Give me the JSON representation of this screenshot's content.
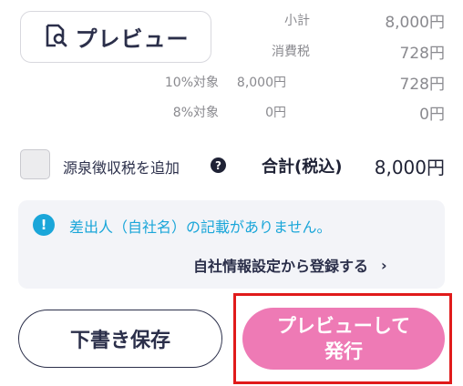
{
  "preview_button": {
    "label": "プレビュー"
  },
  "summary": {
    "subtotal": {
      "label": "小計",
      "value": "8,000円"
    },
    "tax": {
      "label": "消費税",
      "value": "728円"
    },
    "rows": [
      {
        "rate": "10%対象",
        "amount": "8,000円",
        "tax": "728円"
      },
      {
        "rate": "8%対象",
        "amount": "0円",
        "tax": "0円"
      }
    ]
  },
  "withholding": {
    "label": "源泉徴収税を追加",
    "help": "?"
  },
  "total": {
    "label": "合計(税込)",
    "value": "8,000円"
  },
  "alert": {
    "icon": "!",
    "message": "差出人（自社名）の記載がありません。",
    "link_label": "自社情報設定から登録する",
    "link_chevron": "›"
  },
  "actions": {
    "draft_label": "下書き保存",
    "issue_label": "プレビューして\n発行"
  },
  "colors": {
    "accent_pink": "#ee7ab5",
    "info_blue": "#1aa6d9",
    "highlight_red": "#e01b1b",
    "navy": "#2b2f4a"
  }
}
